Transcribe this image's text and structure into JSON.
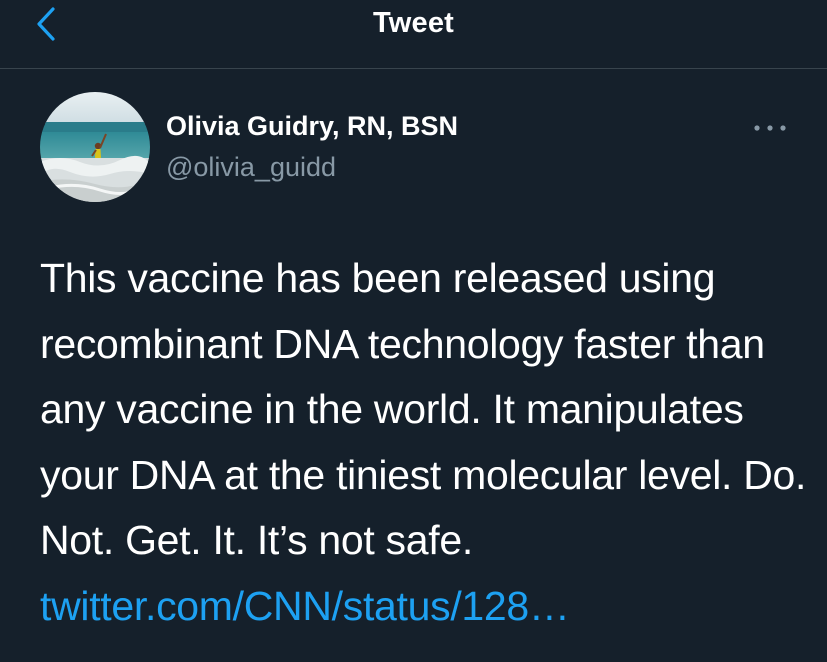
{
  "header": {
    "title": "Tweet",
    "back_icon": "chevron-left-icon"
  },
  "author": {
    "name": "Olivia Guidry, RN, BSN",
    "handle": "@olivia_guidd"
  },
  "tweet": {
    "text": "This vaccine has been released using recombinant DNA technology faster than any vaccine in the world. It manipulates your DNA at the tiniest molecular level. Do. Not. Get. It. It’s not safe. ",
    "link_text": "twitter.com/CNN/status/128…"
  },
  "colors": {
    "background": "#15202b",
    "divider": "#38444d",
    "accent": "#1da1f2",
    "secondary_text": "#8899a6"
  }
}
